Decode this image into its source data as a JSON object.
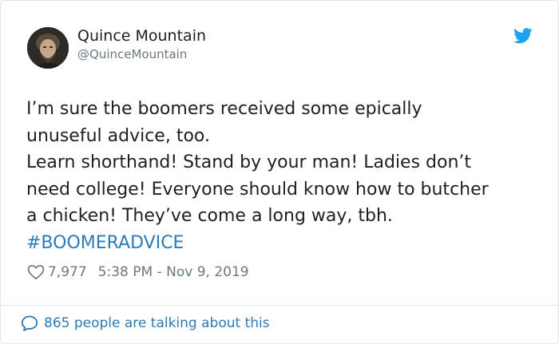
{
  "author": {
    "name": "Quince Mountain",
    "handle": "@QuinceMountain"
  },
  "icons": {
    "brand": "twitter-bird-icon",
    "like": "heart-icon",
    "reply": "speech-bubble-icon"
  },
  "colors": {
    "brand": "#1da1f2",
    "link": "#2b7bb9",
    "muted": "#697882",
    "text": "#1c2022"
  },
  "tweet": {
    "lines": [
      "I’m sure the boomers received some epically",
      "unuseful advice, too.",
      "Learn shorthand! Stand by your man! Ladies don’t",
      "need college! Everyone should know how to butcher",
      "a chicken! They’ve come a long way, tbh."
    ],
    "hashtag": "#BOOMERADVICE"
  },
  "stats": {
    "likes": "7,977",
    "timestamp": "5:38 PM - Nov 9, 2019"
  },
  "footer": {
    "discussion": "865 people are talking about this"
  }
}
